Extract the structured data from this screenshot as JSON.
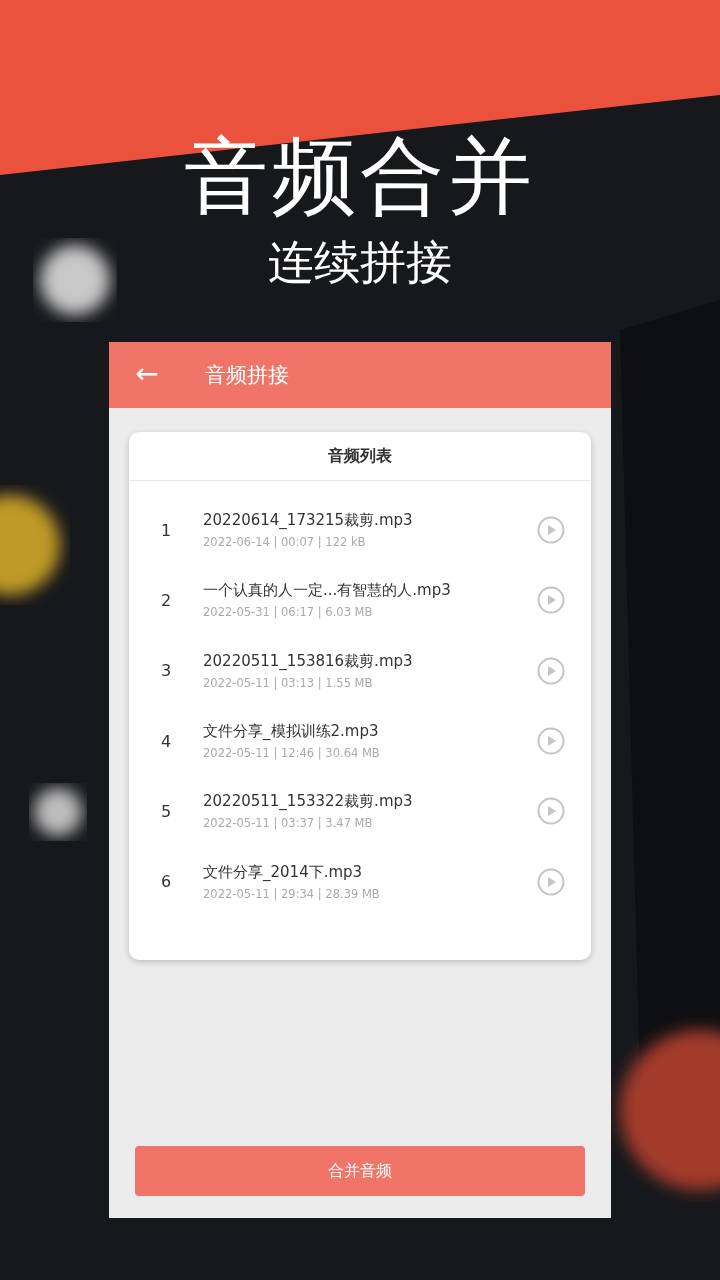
{
  "headline": {
    "title": "音频合并",
    "subtitle": "连续拼接"
  },
  "app": {
    "header": {
      "back_icon": "←",
      "title": "音频拼接"
    },
    "list": {
      "title": "音频列表",
      "items": [
        {
          "index": "1",
          "name": "20220614_173215裁剪.mp3",
          "meta": "2022-06-14 | 00:07 | 122 kB"
        },
        {
          "index": "2",
          "name": "一个认真的人一定...有智慧的人.mp3",
          "meta": "2022-05-31 | 06:17 | 6.03 MB"
        },
        {
          "index": "3",
          "name": "20220511_153816裁剪.mp3",
          "meta": "2022-05-11 | 03:13 | 1.55 MB"
        },
        {
          "index": "4",
          "name": "文件分享_模拟训练2.mp3",
          "meta": "2022-05-11 | 12:46 | 30.64 MB"
        },
        {
          "index": "5",
          "name": "20220511_153322裁剪.mp3",
          "meta": "2022-05-11 | 03:37 | 3.47 MB"
        },
        {
          "index": "6",
          "name": "文件分享_2014下.mp3",
          "meta": "2022-05-11 | 29:34 | 28.39 MB"
        }
      ]
    },
    "merge_button": "合并音频"
  }
}
